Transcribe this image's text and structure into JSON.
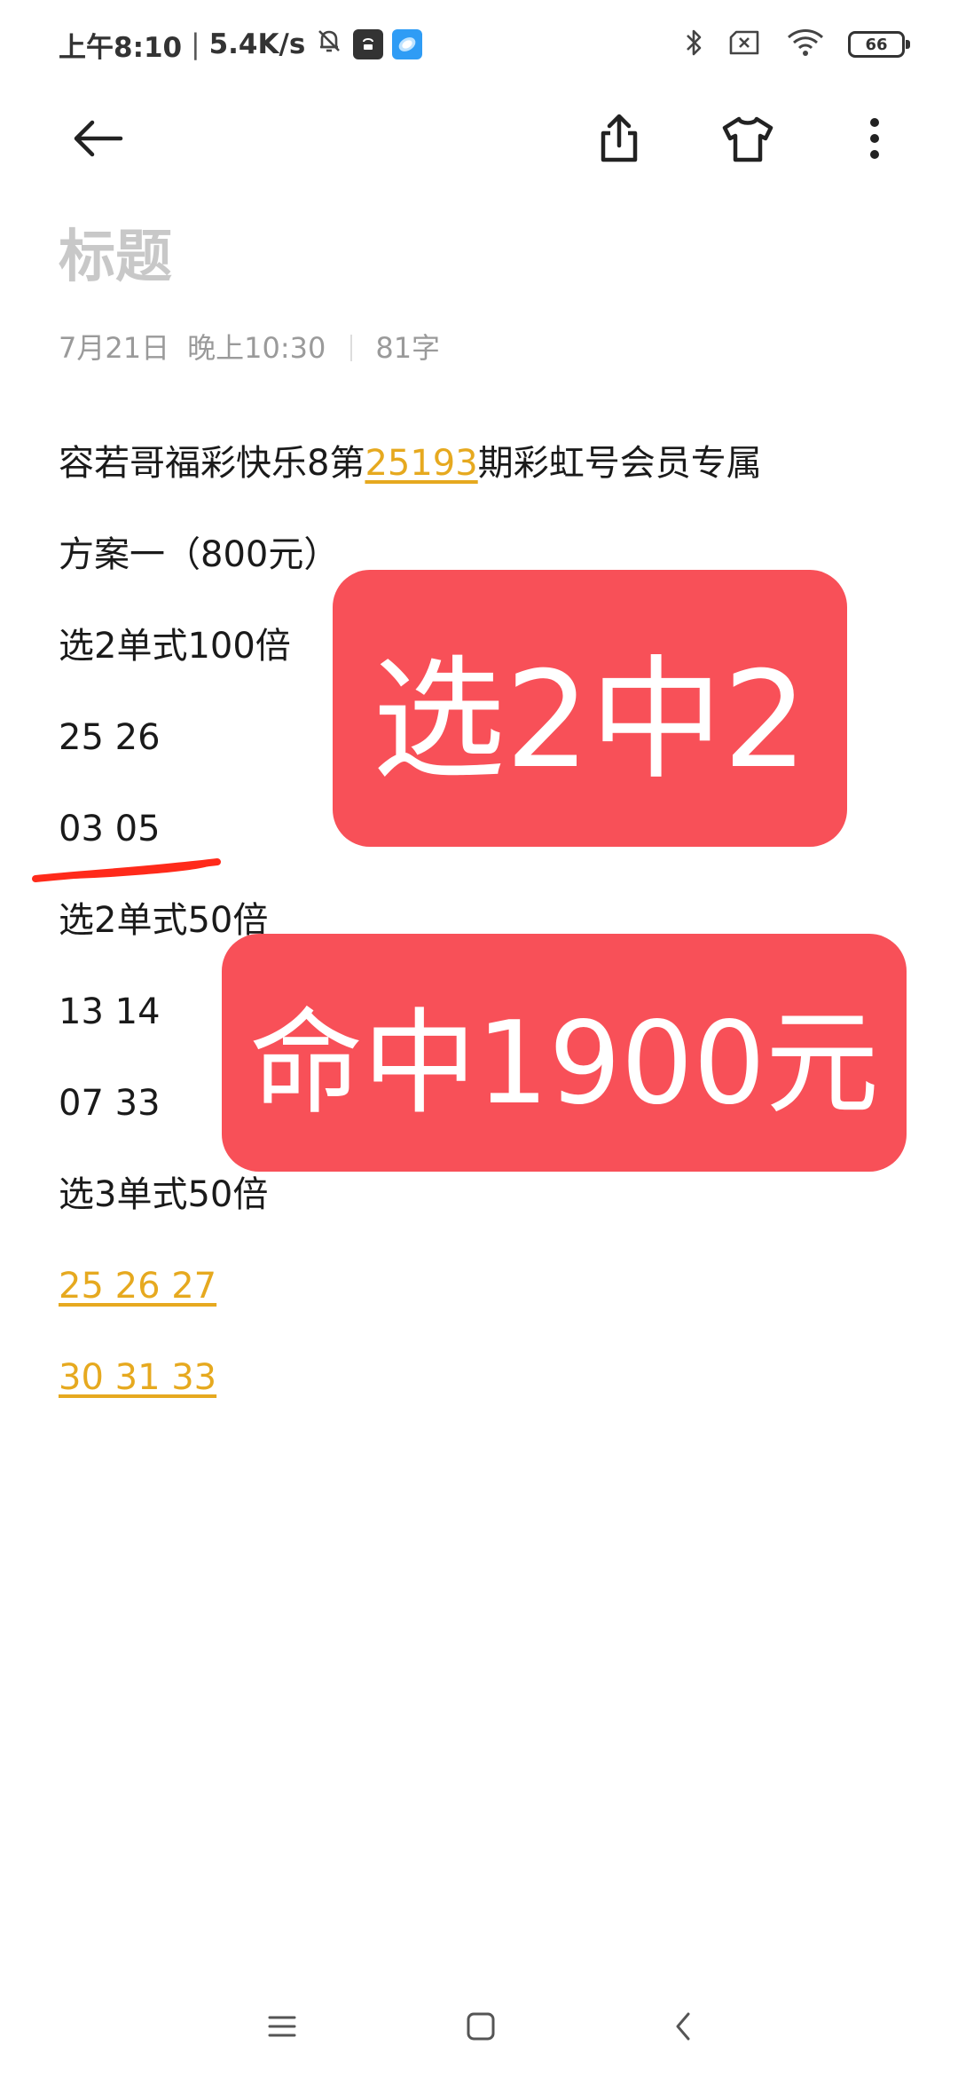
{
  "status_bar": {
    "time": "上午8:10",
    "separator": "|",
    "network_speed": "5.4K/s",
    "battery": "66",
    "icons": [
      "mute-bell-icon",
      "mi-store-icon",
      "app-icon",
      "bluetooth-icon",
      "no-sim-icon",
      "wifi-icon",
      "battery-icon"
    ]
  },
  "toolbar": {
    "icons": [
      "back-arrow-icon",
      "share-icon",
      "theme-shirt-icon",
      "more-vertical-icon"
    ]
  },
  "note": {
    "title_placeholder": "标题",
    "date": "7月21日",
    "time": "晚上10:30",
    "char_count": "81字",
    "lines": [
      {
        "parts": [
          "容若哥福彩快乐8第",
          "25193",
          "期彩虹号会员专属"
        ]
      },
      {
        "text": "方案一（800元）"
      },
      {
        "text": "选2单式100倍"
      },
      {
        "text": "25 26"
      },
      {
        "text": "03 05"
      },
      {
        "text": "选2单式50倍"
      },
      {
        "text": "13 14"
      },
      {
        "text": "07 33"
      },
      {
        "text": "选3单式50倍"
      },
      {
        "text": "25 26 27",
        "style": "link"
      },
      {
        "text": "30 31 33",
        "style": "link"
      }
    ]
  },
  "overlays": {
    "banner_1": "选2中2",
    "banner_2": "命中1900元"
  },
  "colors": {
    "banner_red": "#f85058",
    "link_yellow": "#e6a91f",
    "title_placeholder": "#c8c8c8",
    "meta_gray": "#9a9a9a",
    "squiggle_red": "#ff2a1a"
  },
  "nav_bar": {
    "icons": [
      "menu-icon",
      "home-square-icon",
      "back-chevron-icon"
    ]
  }
}
